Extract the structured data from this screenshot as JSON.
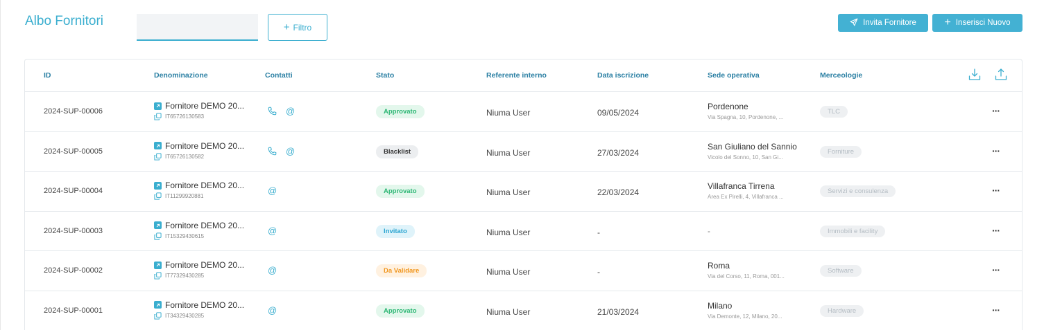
{
  "header": {
    "title": "Albo Fornitori",
    "search_value": "",
    "filter_label": "Filtro",
    "invite_label": "Invita Fornitore",
    "new_label": "Inserisci Nuovo"
  },
  "table": {
    "columns": {
      "id": "ID",
      "name": "Denominazione",
      "contacts": "Contatti",
      "status": "Stato",
      "referent": "Referente interno",
      "date": "Data iscrizione",
      "site": "Sede operativa",
      "categories": "Merceologie"
    },
    "rows": [
      {
        "id": "2024-SUP-00006",
        "name": "Fornitore DEMO 20...",
        "vat": "IT65726130583",
        "contacts": [
          "phone",
          "email"
        ],
        "status": "Approvato",
        "status_kind": "approved",
        "referent": "Niuma User",
        "date": "09/05/2024",
        "city": "Pordenone",
        "address": "Via Spagna, 10, Pordenone, ...",
        "category": "TLC"
      },
      {
        "id": "2024-SUP-00005",
        "name": "Fornitore DEMO 20...",
        "vat": "IT65726130582",
        "contacts": [
          "phone",
          "email"
        ],
        "status": "Blacklist",
        "status_kind": "blacklist",
        "referent": "Niuma User",
        "date": "27/03/2024",
        "city": "San Giuliano del Sannio",
        "address": "Vicolo del Sonno, 10, San Gi...",
        "category": "Forniture"
      },
      {
        "id": "2024-SUP-00004",
        "name": "Fornitore DEMO 20...",
        "vat": "IT11299920881",
        "contacts": [
          "email"
        ],
        "status": "Approvato",
        "status_kind": "approved",
        "referent": "Niuma User",
        "date": "22/03/2024",
        "city": "Villafranca Tirrena",
        "address": "Area Ex Pirelli, 4, Villafranca ...",
        "category": "Servizi e consulenza"
      },
      {
        "id": "2024-SUP-00003",
        "name": "Fornitore DEMO 20...",
        "vat": "IT15329430615",
        "contacts": [
          "email"
        ],
        "status": "Invitato",
        "status_kind": "invited",
        "referent": "Niuma User",
        "date": "-",
        "city": "-",
        "address": "",
        "category": "Immobili e facility"
      },
      {
        "id": "2024-SUP-00002",
        "name": "Fornitore DEMO 20...",
        "vat": "IT77329430285",
        "contacts": [
          "email"
        ],
        "status": "Da Validare",
        "status_kind": "pending",
        "referent": "Niuma User",
        "date": "-",
        "city": "Roma",
        "address": "Via del Corso, 11, Roma, 001...",
        "category": "Software"
      },
      {
        "id": "2024-SUP-00001",
        "name": "Fornitore DEMO 20...",
        "vat": "IT34329430285",
        "contacts": [
          "email"
        ],
        "status": "Approvato",
        "status_kind": "approved",
        "referent": "Niuma User",
        "date": "21/03/2024",
        "city": "Milano",
        "address": "Via Demonte, 12, Milano, 20...",
        "category": "Hardware"
      }
    ]
  },
  "colors": {
    "accent": "#3aaecf",
    "header_text": "#2a7fa3",
    "approved_bg": "#e3f7ec",
    "approved_fg": "#2bb673",
    "blacklist_bg": "#eceef0",
    "blacklist_fg": "#333333",
    "invited_bg": "#dff3fa",
    "invited_fg": "#2aa4d0",
    "pending_bg": "#fff1e0",
    "pending_fg": "#f0961e"
  },
  "icons": {
    "invite": "paper-plane-icon",
    "new": "plus-icon",
    "download": "download-icon",
    "upload": "upload-icon",
    "phone": "phone-icon",
    "email": "at-icon",
    "external": "external-link-icon",
    "copy": "copy-icon",
    "more": "more-icon"
  }
}
